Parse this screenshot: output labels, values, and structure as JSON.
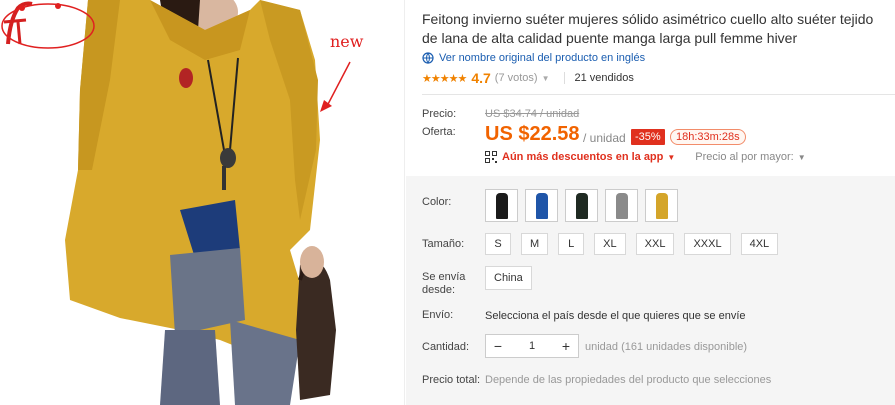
{
  "image": {
    "new_badge": "new"
  },
  "product": {
    "title": "Feitong invierno suéter mujeres sólido asimétrico cuello alto suéter tejido de lana de alta calidad puente manga larga pull femme hiver",
    "orig_link": "Ver nombre original del producto en inglés",
    "stars": "★★★★★",
    "rating": "4.7",
    "votes": "(7 votos)",
    "sold": "21 vendidos"
  },
  "price": {
    "price_label": "Precio:",
    "old_price": "US $34.74 / unidad",
    "offer_label": "Oferta:",
    "new_price": "US $22.58",
    "unit": "/ unidad",
    "discount": "-35%",
    "timer": "18h:33m:28s",
    "app_discount": "Aún más descuentos en la app",
    "bulk": "Precio al por mayor:"
  },
  "options": {
    "color_label": "Color:",
    "colors": [
      "#1a1a1a",
      "#1f55a8",
      "#1f2a22",
      "#8a8a8a",
      "#d4a52a"
    ],
    "size_label": "Tamaño:",
    "sizes": [
      "S",
      "M",
      "L",
      "XL",
      "XXL",
      "XXXL",
      "4XL"
    ],
    "ship_from_label": "Se envía desde:",
    "ship_from_value": "China",
    "shipping_label": "Envío:",
    "shipping_text": "Selecciona el país desde el que quieres que se envíe",
    "qty_label": "Cantidad:",
    "qty_value": "1",
    "qty_minus": "−",
    "qty_plus": "+",
    "qty_unit": "unidad (161 unidades disponible)",
    "total_label": "Precio total:",
    "total_text": "Depende de las propiedades del producto que selecciones"
  }
}
